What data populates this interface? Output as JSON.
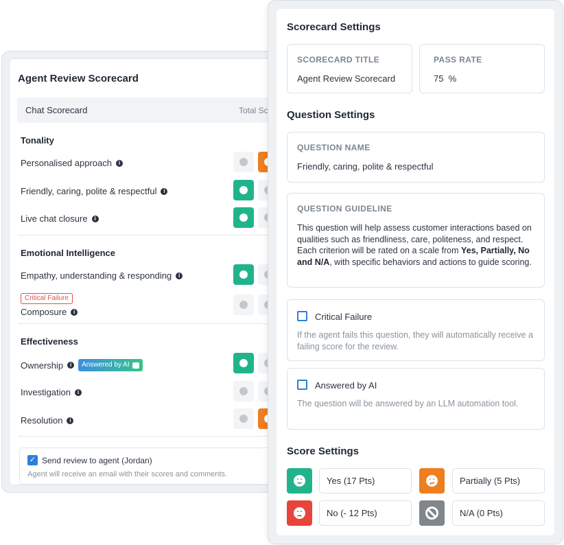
{
  "review": {
    "title": "Agent Review Scorecard",
    "header_label": "Chat Scorecard",
    "header_total": "Total Score",
    "sections": [
      {
        "name": "Tonality",
        "questions": [
          {
            "label": "Personalised approach",
            "selected": "partially"
          },
          {
            "label": "Friendly, caring, polite & respectful",
            "selected": "yes"
          },
          {
            "label": "Live chat closure",
            "selected": "yes"
          }
        ]
      },
      {
        "name": "Emotional Intelligence",
        "questions": [
          {
            "label": "Empathy, understanding & responding",
            "selected": "yes"
          },
          {
            "label": "Composure",
            "selected": "none",
            "badge": "Critical Failure"
          }
        ]
      },
      {
        "name": "Effectiveness",
        "questions": [
          {
            "label": "Ownership",
            "selected": "yes",
            "badge": "Answered by AI"
          },
          {
            "label": "Investigation",
            "selected": "none"
          },
          {
            "label": "Resolution",
            "selected": "partially"
          }
        ]
      }
    ],
    "send_review": {
      "label": "Send review to agent (Jordan)",
      "checked": true,
      "description": "Agent will receive an email with their scores and comments."
    }
  },
  "settings": {
    "title": "Scorecard Settings",
    "scorecard_title_caption": "SCORECARD TITLE",
    "scorecard_title_value": "Agent Review Scorecard",
    "pass_rate_caption": "PASS RATE",
    "pass_rate_value": "75  %",
    "question_settings_title": "Question Settings",
    "question_name_caption": "QUESTION NAME",
    "question_name_value": "Friendly, caring, polite & respectful",
    "guideline_caption": "QUESTION GUIDELINE",
    "guideline_text_1": "This question will help assess customer interactions based on qualities such as friendliness, care, politeness, and respect. Each criterion will be rated on a scale from ",
    "guideline_bold": "Yes, Partially, No and N/A",
    "guideline_text_2": ", with specific behaviors and actions to guide scoring.",
    "critical_failure": {
      "label": "Critical Failure",
      "checked": false,
      "description": "If the agent fails this question, they will automatically receive a failing score for the review."
    },
    "answered_by_ai": {
      "label": "Answered by AI",
      "checked": false,
      "description": "The question will be answered by an LLM automation tool."
    },
    "score_settings_title": "Score Settings",
    "scores": {
      "yes": "Yes (17 Pts)",
      "partially": "Partially (5 Pts)",
      "no": "No (- 12 Pts)",
      "na": "N/A (0 Pts)"
    }
  },
  "colors": {
    "yes": "#21b48c",
    "partially": "#ee7e1f",
    "no": "#e7453c",
    "na": "#7f878d",
    "accent": "#2d7fd9",
    "critical": "#e0504a"
  }
}
